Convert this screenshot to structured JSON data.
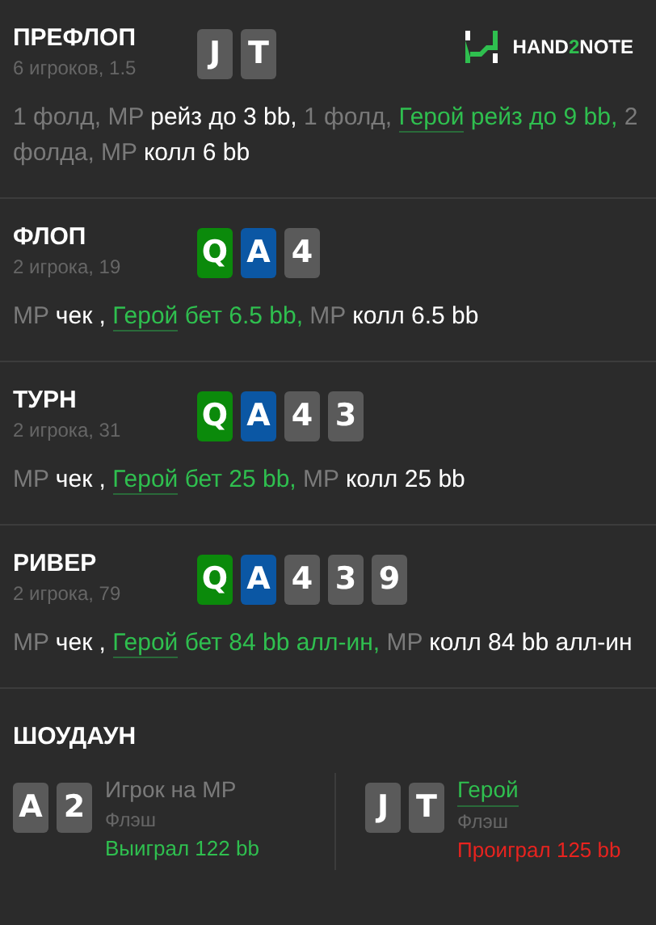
{
  "logo": {
    "parts": [
      {
        "text": "HAND",
        "accent": false
      },
      {
        "text": "2",
        "accent": true
      },
      {
        "text": "NOTE",
        "accent": false
      }
    ]
  },
  "streets": [
    {
      "title": "ПРЕФЛОП",
      "subtitle": "6 игроков, 1.5",
      "cards": [
        {
          "rank": "J",
          "color": "#5a5a5a"
        },
        {
          "rank": "T",
          "color": "#5a5a5a"
        }
      ],
      "actions": [
        {
          "kind": "muted",
          "text": "1 фолд, MP "
        },
        {
          "kind": "strong",
          "text": "рейз до 3 bb,"
        },
        {
          "kind": "muted",
          "text": " 1 фолд, "
        },
        {
          "kind": "hero",
          "text": "Герой"
        },
        {
          "kind": "hero_action",
          "text": " рейз до 9 bb,"
        },
        {
          "kind": "muted",
          "text": " 2 фолда, MP "
        },
        {
          "kind": "strong",
          "text": "колл 6 bb"
        }
      ]
    },
    {
      "title": "ФЛОП",
      "subtitle": "2 игрока, 19",
      "cards": [
        {
          "rank": "Q",
          "color": "#0b8a0b"
        },
        {
          "rank": "A",
          "color": "#0b57a4"
        },
        {
          "rank": "4",
          "color": "#5a5a5a"
        }
      ],
      "actions": [
        {
          "kind": "muted",
          "text": "MP "
        },
        {
          "kind": "strong",
          "text": "чек , "
        },
        {
          "kind": "hero",
          "text": "Герой"
        },
        {
          "kind": "hero_action",
          "text": " бет 6.5 bb,"
        },
        {
          "kind": "muted",
          "text": " MP "
        },
        {
          "kind": "strong",
          "text": "колл 6.5 bb"
        }
      ]
    },
    {
      "title": "ТУРН",
      "subtitle": "2 игрока, 31",
      "cards": [
        {
          "rank": "Q",
          "color": "#0b8a0b"
        },
        {
          "rank": "A",
          "color": "#0b57a4"
        },
        {
          "rank": "4",
          "color": "#5a5a5a"
        },
        {
          "rank": "3",
          "color": "#5a5a5a"
        }
      ],
      "actions": [
        {
          "kind": "muted",
          "text": "MP "
        },
        {
          "kind": "strong",
          "text": "чек , "
        },
        {
          "kind": "hero",
          "text": "Герой"
        },
        {
          "kind": "hero_action",
          "text": " бет 25 bb,"
        },
        {
          "kind": "muted",
          "text": " MP "
        },
        {
          "kind": "strong",
          "text": "колл 25 bb"
        }
      ]
    },
    {
      "title": "РИВЕР",
      "subtitle": "2 игрока, 79",
      "cards": [
        {
          "rank": "Q",
          "color": "#0b8a0b"
        },
        {
          "rank": "A",
          "color": "#0b57a4"
        },
        {
          "rank": "4",
          "color": "#5a5a5a"
        },
        {
          "rank": "3",
          "color": "#5a5a5a"
        },
        {
          "rank": "9",
          "color": "#5a5a5a"
        }
      ],
      "actions": [
        {
          "kind": "muted",
          "text": "MP "
        },
        {
          "kind": "strong",
          "text": "чек , "
        },
        {
          "kind": "hero",
          "text": "Герой"
        },
        {
          "kind": "hero_action",
          "text": " бет 84 bb алл-ин,"
        },
        {
          "kind": "muted",
          "text": " MP "
        },
        {
          "kind": "strong",
          "text": "колл 84 bb алл-ин"
        }
      ]
    }
  ],
  "showdown": {
    "title": "ШОУДАУН",
    "players": [
      {
        "cards": [
          {
            "rank": "A",
            "color": "#5a5a5a"
          },
          {
            "rank": "2",
            "color": "#5a5a5a"
          }
        ],
        "name": "Игрок на MP",
        "is_hero": false,
        "hand": "Флэш",
        "result": "Выиграл 122 bb",
        "kind": "win"
      },
      {
        "cards": [
          {
            "rank": "J",
            "color": "#5a5a5a"
          },
          {
            "rank": "T",
            "color": "#5a5a5a"
          }
        ],
        "name": "Герой",
        "is_hero": true,
        "hand": "Флэш",
        "result": "Проиграл 125 bb",
        "kind": "loss"
      }
    ]
  }
}
